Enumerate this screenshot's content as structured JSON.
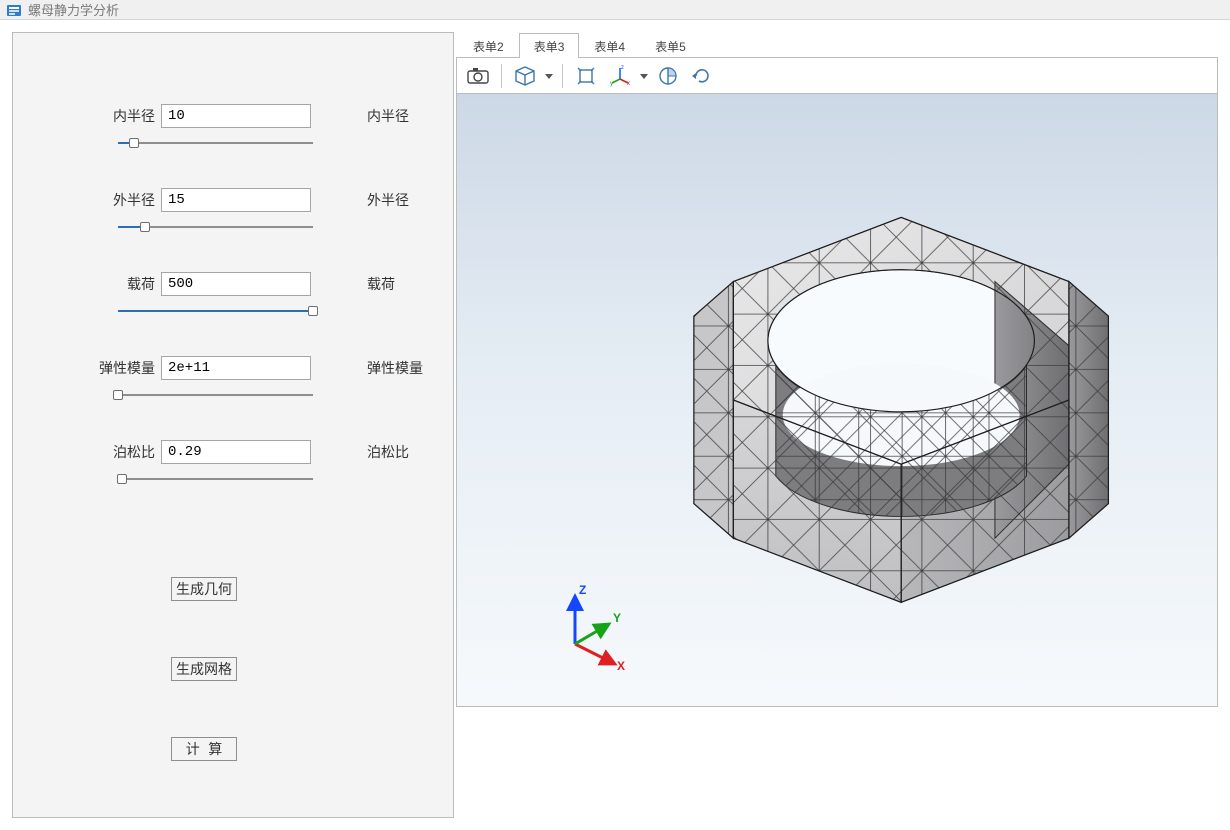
{
  "window": {
    "title": "螺母静力学分析"
  },
  "form": {
    "inner_radius": {
      "label": "内半径",
      "value": "10",
      "right_label": "内半径",
      "slider_pct": 8
    },
    "outer_radius": {
      "label": "外半径",
      "value": "15",
      "right_label": "外半径",
      "slider_pct": 14
    },
    "load": {
      "label": "载荷",
      "value": "500",
      "right_label": "载荷",
      "slider_pct": 100
    },
    "modulus": {
      "label": "弹性模量",
      "value": "2e+11",
      "right_label": "弹性模量",
      "slider_pct": 0
    },
    "poisson": {
      "label": "泊松比",
      "value": "0.29",
      "right_label": "泊松比",
      "slider_pct": 2
    }
  },
  "buttons": {
    "gen_geometry": "生成几何",
    "gen_mesh": "生成网格",
    "compute": "计 算"
  },
  "tabs": [
    {
      "id": "t2",
      "label": "表单2",
      "active": false
    },
    {
      "id": "t3",
      "label": "表单3",
      "active": true
    },
    {
      "id": "t4",
      "label": "表单4",
      "active": false
    },
    {
      "id": "t5",
      "label": "表单5",
      "active": false
    }
  ],
  "axis": {
    "x": "X",
    "y": "Y",
    "z": "Z"
  },
  "toolbar_icons": [
    "camera",
    "cube-view",
    "zoom-extents",
    "axis-select",
    "clip-plane",
    "rotate-reset"
  ]
}
